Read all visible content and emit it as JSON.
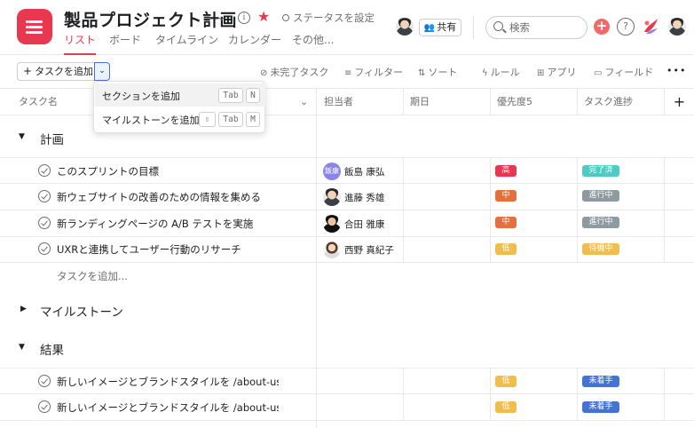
{
  "project": {
    "title": "製品プロジェクト計画",
    "status_label": "ステータスを設定"
  },
  "tabs": [
    {
      "label": "リスト",
      "active": true
    },
    {
      "label": "ボード"
    },
    {
      "label": "タイムライン"
    },
    {
      "label": "カレンダー"
    },
    {
      "label": "その他..."
    }
  ],
  "header": {
    "share_label": "共有",
    "search_placeholder": "検索",
    "plus_label": "+",
    "help_label": "?",
    "info_label": "i"
  },
  "toolbar": {
    "add_task_label": "タスクを追加",
    "incomplete_label": "未完了タスク",
    "filter_label": "フィルター",
    "sort_label": "ソート",
    "rule_label": "ルール",
    "apps_label": "アプリ",
    "fields_label": "フィールド",
    "more_label": "•••"
  },
  "dropdown": {
    "items": [
      {
        "label": "セクションを追加",
        "keys": [
          "Tab",
          "N"
        ]
      },
      {
        "label": "マイルストーンを追加",
        "keys": [
          "⇧",
          "Tab",
          "M"
        ]
      }
    ]
  },
  "columns": {
    "task_name": "タスク名",
    "assignee": "担当者",
    "due": "期日",
    "priority": "優先度5",
    "progress": "タスク進捗",
    "add": "+"
  },
  "sections": [
    {
      "name": "計画",
      "tasks": [
        {
          "name": "このスプリントの目標",
          "assignee": "飯島 康弘",
          "initials": "飯康",
          "priority": "高",
          "progress": "完了済"
        },
        {
          "name": "新ウェブサイトの改善のための情報を集める",
          "assignee": "進藤 秀雄",
          "priority": "中",
          "progress": "進行中"
        },
        {
          "name": "新ランディングページの A/B テストを実施",
          "assignee": "合田 雅康",
          "priority": "中",
          "progress": "進行中"
        },
        {
          "name": "UXRと連携してユーザー行動のリサーチ",
          "assignee": "西野 真紀子",
          "priority": "低",
          "progress": "待機中"
        }
      ],
      "add_task_label": "タスクを追加..."
    },
    {
      "name": "マイルストーン"
    },
    {
      "name": "結果",
      "tasks": [
        {
          "name": "新しいイメージとブランドスタイルを /about-us に適用",
          "priority": "低",
          "progress": "未着手"
        },
        {
          "name": "新しいイメージとブランドスタイルを /about-us に適用",
          "priority": "低",
          "progress": "未着手"
        }
      ]
    }
  ],
  "colors": {
    "accent": "#e8384f",
    "priority_high": "#e8384f",
    "priority_mid": "#e3703e",
    "priority_low": "#f1bd4c",
    "done": "#4ecbc4",
    "in_progress": "#8d9aa0",
    "waiting": "#f1bd4c",
    "not_started": "#4573d2"
  }
}
